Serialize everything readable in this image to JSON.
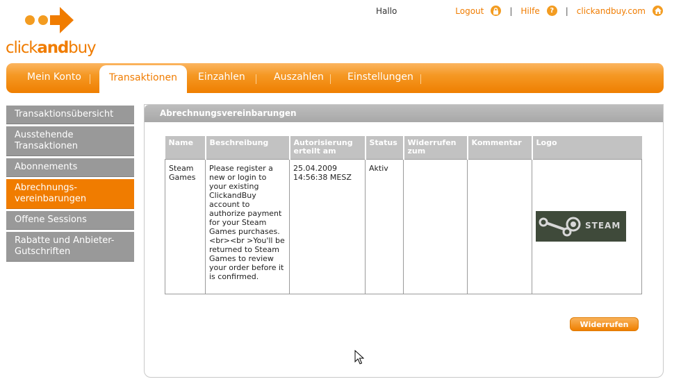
{
  "brand": {
    "word_light": "click",
    "word_bold": "and",
    "word_light2": "buy",
    "color": "#f07c00"
  },
  "header": {
    "greeting": "Hallo",
    "links": [
      {
        "label": "Logout",
        "icon": "lock-icon"
      },
      {
        "label": "Hilfe",
        "icon": "help-icon"
      },
      {
        "label": "clickandbuy.com",
        "icon": "home-icon"
      }
    ],
    "separator": "|"
  },
  "nav": {
    "tabs": [
      "Mein Konto",
      "Transaktionen",
      "Einzahlen",
      "Auszahlen",
      "Einstellungen"
    ],
    "active": "Transaktionen"
  },
  "sidebar": {
    "items": [
      "Transaktionsübersicht",
      "Ausstehende Transaktionen",
      "Abonnements",
      "Abrechnungs-vereinbarungen",
      "Offene Sessions",
      "Rabatte und Anbieter-Gutschriften"
    ],
    "active": "Abrechnungs-vereinbarungen"
  },
  "panel": {
    "title": "Abrechnungsvereinbarungen",
    "columns": [
      "Name",
      "Beschreibung",
      "Autorisierung erteilt am",
      "Status",
      "Widerrufen zum",
      "Kommentar",
      "Logo"
    ],
    "rows": [
      {
        "name": "Steam Games",
        "description": "Please register a new or login to your existing ClickandBuy account to authorize payment for your Steam Games purchases. <br><br >You'll be returned to Steam Games to review your order before it is confirmed.",
        "authorized": "25.04.2009 14:56:38 MESZ",
        "status": "Aktiv",
        "revoked": "",
        "comment": "",
        "logo_text": "STEAM"
      }
    ],
    "revoke_button": "Widerrufen"
  },
  "colors": {
    "accent": "#f07c00",
    "sidebar_bg": "#999999",
    "header_gray": "#c2c2c2"
  }
}
